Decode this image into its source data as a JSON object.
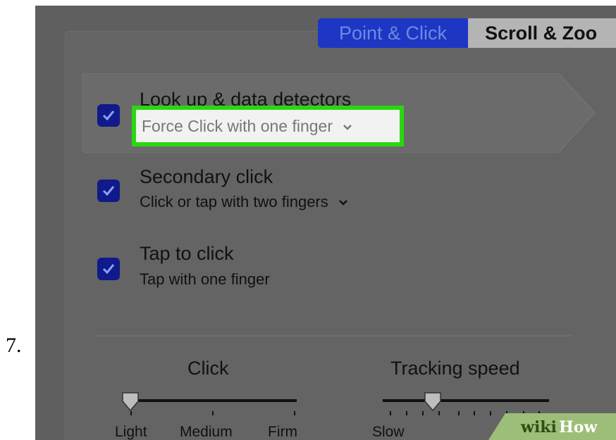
{
  "step_number": "7.",
  "tabs": [
    {
      "label": "Point & Click",
      "active": true
    },
    {
      "label": "Scroll & Zoo",
      "active": false
    }
  ],
  "options": [
    {
      "title": "Look up & data detectors",
      "subtitle": "Force Click with one finger",
      "checked": true,
      "selected": true,
      "highlighted": true
    },
    {
      "title": "Secondary click",
      "subtitle": "Click or tap with two fingers",
      "checked": true,
      "selected": false,
      "highlighted": false
    },
    {
      "title": "Tap to click",
      "subtitle": "Tap with one finger",
      "checked": true,
      "selected": false,
      "highlighted": false
    }
  ],
  "sliders": {
    "click": {
      "title": "Click",
      "labels": [
        "Light",
        "Medium",
        "Firm"
      ],
      "value": 0
    },
    "tracking": {
      "title": "Tracking speed",
      "labels": [
        "Slow"
      ],
      "value": 0.3
    }
  },
  "watermark": {
    "part1": "wiki",
    "part2": "How"
  },
  "colors": {
    "active_tab": "#1d36c4",
    "checkbox": "#101a8a",
    "highlight_border": "#29d80f",
    "background": "#5f5f5f"
  },
  "icons": {
    "checkbox": "checkmark-icon",
    "dropdown": "chevron-down-icon",
    "slider_knob": "slider-knob-icon"
  }
}
